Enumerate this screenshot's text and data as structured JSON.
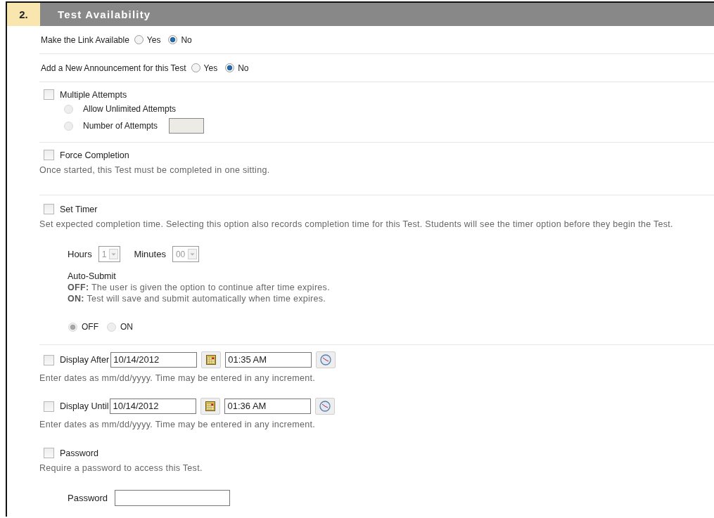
{
  "section": {
    "number": "2.",
    "title": "Test Availability"
  },
  "rows": [
    {
      "kind": "radio-question",
      "label": "Make the Link Available",
      "options": [
        {
          "label": "Yes",
          "selected": false
        },
        {
          "label": "No",
          "selected": true
        }
      ]
    },
    {
      "kind": "radio-question",
      "label": "Add a New Announcement for this Test",
      "options": [
        {
          "label": "Yes",
          "selected": false
        },
        {
          "label": "No",
          "selected": true
        }
      ]
    },
    {
      "kind": "multiple-attempts",
      "checkbox": {
        "label": "Multiple Attempts",
        "checked": false
      },
      "options": [
        {
          "kind": "plain",
          "label": "Allow Unlimited Attempts",
          "selected": false,
          "disabled": true
        },
        {
          "kind": "with-field",
          "label": "Number of Attempts",
          "selected": false,
          "disabled": true
        }
      ]
    },
    {
      "kind": "checkbox-section",
      "checkbox": {
        "label": "Force Completion",
        "checked": false
      },
      "description": "Once started, this Test must be completed in one sitting."
    },
    {
      "kind": "timer",
      "checkbox": {
        "label": "Set Timer",
        "checked": false
      },
      "description": "Set expected completion time. Selecting this option also records completion time for this Test. Students will see the timer option before they begin the Test.",
      "hours": {
        "label": "Hours",
        "value": "1",
        "disabled": true
      },
      "minutes": {
        "label": "Minutes",
        "value": "00",
        "disabled": true
      },
      "auto_submit": {
        "title": "Auto-Submit",
        "notes": [
          "**OFF:** The user is given the option to continue after time expires.",
          "**ON:** Test will save and submit automatically when time expires."
        ],
        "options": [
          {
            "label": "OFF",
            "selected": true,
            "disabled": true
          },
          {
            "label": "ON",
            "selected": false,
            "disabled": true
          }
        ]
      }
    },
    {
      "kind": "date-time",
      "checkbox": {
        "label": "Display After",
        "checked": false
      },
      "date": "10/14/2012",
      "time": "01:35 AM",
      "description": "Enter dates as mm/dd/yyyy. Time may be entered in any increment."
    },
    {
      "kind": "date-time",
      "checkbox": {
        "label": "Display Until",
        "checked": false
      },
      "date": "10/14/2012",
      "time": "01:36 AM",
      "description": "Enter dates as mm/dd/yyyy. Time may be entered in any increment."
    },
    {
      "kind": "password",
      "checkbox": {
        "label": "Password",
        "checked": false
      },
      "description": "Require a password to access this Test.",
      "field_label": "Password"
    }
  ]
}
